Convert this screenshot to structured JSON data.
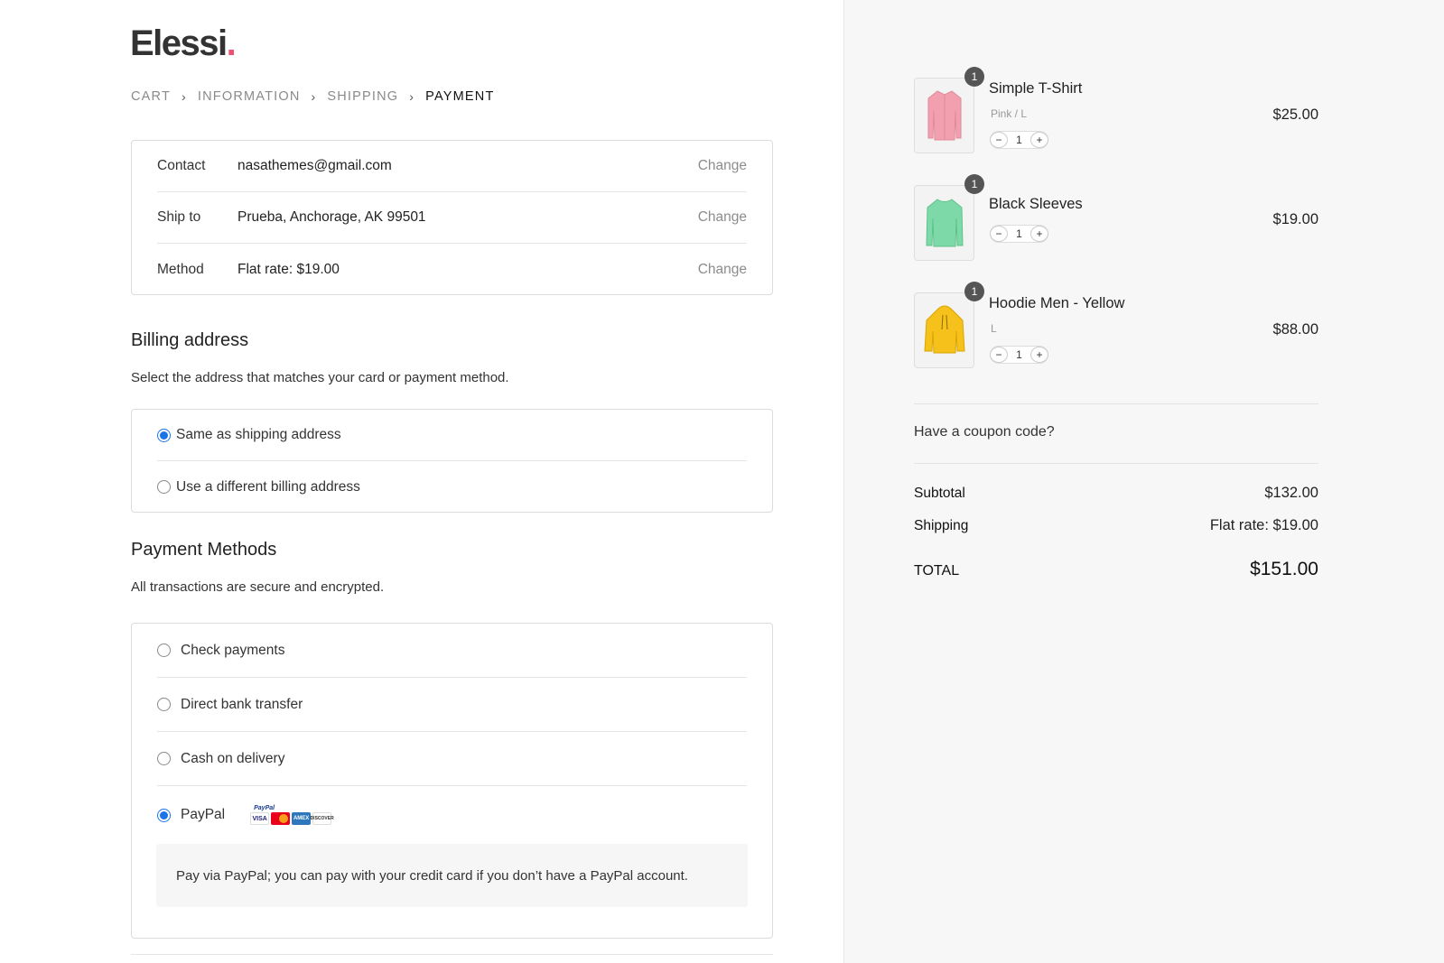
{
  "brand": {
    "name": "Elessi",
    "dot": ".",
    "accent": "#f0506e"
  },
  "breadcrumb": [
    {
      "label": "CART",
      "active": false
    },
    {
      "label": "INFORMATION",
      "active": false
    },
    {
      "label": "SHIPPING",
      "active": false
    },
    {
      "label": "PAYMENT",
      "active": true
    }
  ],
  "review": {
    "rows": [
      {
        "label": "Contact",
        "value": "nasathemes@gmail.com",
        "action": "Change"
      },
      {
        "label": "Ship to",
        "value": "Prueba, Anchorage, AK 99501",
        "action": "Change"
      },
      {
        "label": "Method",
        "value": "Flat rate: $19.00",
        "action": "Change"
      }
    ]
  },
  "billing": {
    "title": "Billing address",
    "subtitle": "Select the address that matches your card or payment method.",
    "options": [
      {
        "label": "Same as shipping address",
        "checked": true
      },
      {
        "label": "Use a different billing address",
        "checked": false
      }
    ]
  },
  "payment": {
    "title": "Payment Methods",
    "subtitle": "All transactions are secure and encrypted.",
    "options": [
      {
        "label": "Check payments",
        "checked": false
      },
      {
        "label": "Direct bank transfer",
        "checked": false
      },
      {
        "label": "Cash on delivery",
        "checked": false
      },
      {
        "label": "PayPal",
        "checked": true
      }
    ],
    "paypal_logo": {
      "word": "PayPal",
      "cards": [
        "VISA",
        "mastercard-icon",
        "AMEX",
        "DISCOVER"
      ]
    },
    "paypal_note": "Pay via PayPal; you can pay with your credit card if you don’t have a PayPal account."
  },
  "cart": {
    "items": [
      {
        "name": "Simple T-Shirt",
        "variant": "Pink  /  L",
        "quantity": "1",
        "badge": "1",
        "price": "$25.00",
        "image": "pink-shirt-icon",
        "color": "#f2a0b0"
      },
      {
        "name": "Black Sleeves",
        "variant": "",
        "quantity": "1",
        "badge": "1",
        "price": "$19.00",
        "image": "green-sweater-icon",
        "color": "#7ed9a8"
      },
      {
        "name": "Hoodie Men - Yellow",
        "variant": "L",
        "quantity": "1",
        "badge": "1",
        "price": "$88.00",
        "image": "yellow-hoodie-icon",
        "color": "#f5c11a"
      }
    ],
    "stepper": {
      "minus": "−",
      "plus": "+"
    },
    "coupon_label": "Have a coupon code?",
    "subtotal_label": "Subtotal",
    "subtotal_value": "$132.00",
    "shipping_label": "Shipping",
    "shipping_value": "Flat rate: $19.00",
    "total_label": "TOTAL",
    "total_value": "$151.00"
  }
}
